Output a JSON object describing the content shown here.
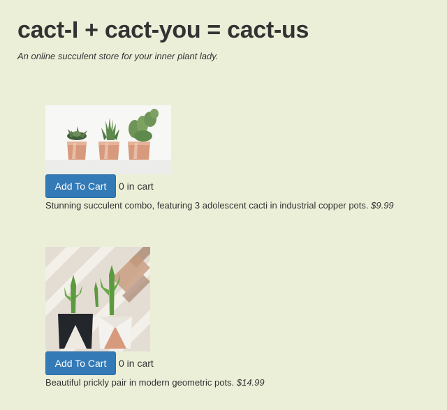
{
  "header": {
    "title": "cact-I + cact-you = cact-us",
    "tagline": "An online succulent store for your inner plant lady."
  },
  "products": [
    {
      "image_alt": "Three cacti in copper pots",
      "button_label": "Add To Cart",
      "cart_count": "0 in cart",
      "description": "Stunning succulent combo, featuring 3 adolescent cacti in industrial copper pots.",
      "price": "$9.99"
    },
    {
      "image_alt": "Two cacti in geometric pots",
      "button_label": "Add To Cart",
      "cart_count": "0 in cart",
      "description": "Beautiful prickly pair in modern geometric pots.",
      "price": "$14.99"
    }
  ],
  "colors": {
    "page_background": "#ecefd8",
    "button_primary": "#337ab7",
    "copper": "#d79a7d"
  }
}
